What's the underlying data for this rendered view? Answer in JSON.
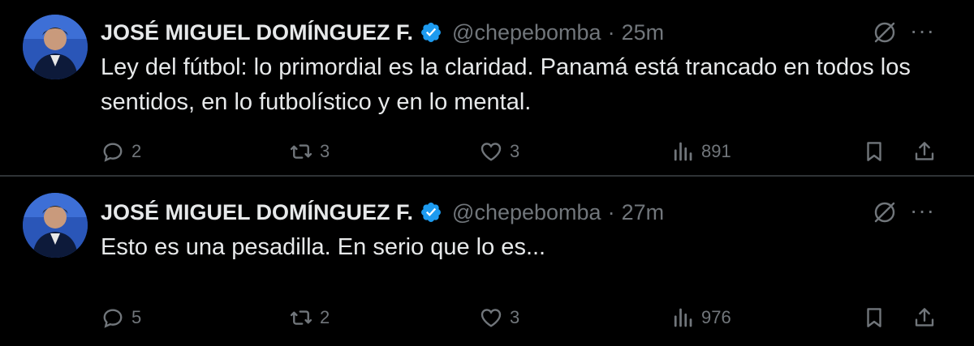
{
  "tweets": [
    {
      "author_name": "JOSÉ MIGUEL DOMÍNGUEZ F.",
      "handle": "@chepebomba",
      "separator": "·",
      "time": "25m",
      "text": "Ley del fútbol: lo primordial es la claridad. Panamá está trancado en todos los sentidos, en lo futbolístico y en lo mental.",
      "replies": "2",
      "reposts": "3",
      "likes": "3",
      "views": "891"
    },
    {
      "author_name": "JOSÉ MIGUEL DOMÍNGUEZ F.",
      "handle": "@chepebomba",
      "separator": "·",
      "time": "27m",
      "text": "Esto es una pesadilla. En serio que lo es...",
      "replies": "5",
      "reposts": "2",
      "likes": "3",
      "views": "976"
    }
  ],
  "more_label": "···",
  "icons": {
    "verified": "verified-badge-icon",
    "grok": "grok-icon",
    "reply": "reply-icon",
    "repost": "repost-icon",
    "like": "heart-icon",
    "views": "views-icon",
    "bookmark": "bookmark-icon",
    "share": "share-icon"
  },
  "colors": {
    "background": "#000000",
    "text": "#e7e9ea",
    "muted": "#71767b",
    "verified": "#1d9bf0",
    "divider": "#2f3336"
  }
}
